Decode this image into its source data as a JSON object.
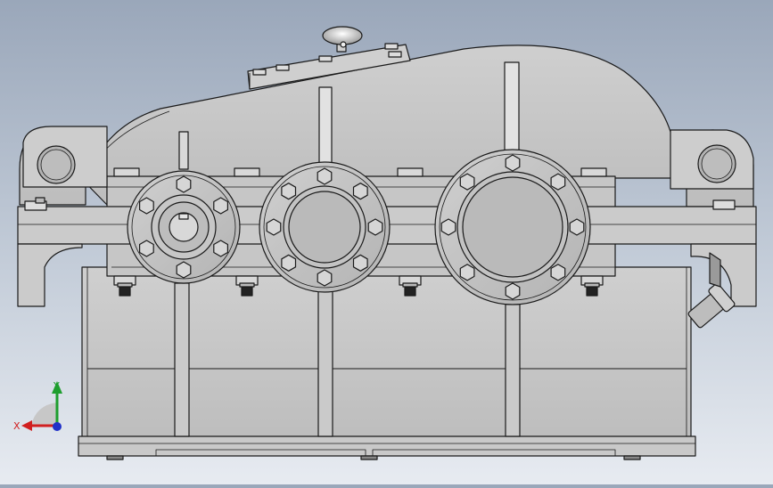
{
  "viewport": {
    "description_visible": false
  },
  "triad": {
    "x_label": "X",
    "y_label": "Y",
    "x_color": "#d11f1f",
    "y_color": "#1e9e2e",
    "z_color": "#2030c8"
  },
  "colors": {
    "body": "#c3c3c3",
    "body_light": "#d4d4d4",
    "body_dark": "#a9a9a9",
    "edge": "#1a1a1a",
    "flange": "#bcbcbc",
    "bolt": "#d8d8d8"
  },
  "model": {
    "shaft_count": 3,
    "flange_bolts": [
      6,
      8,
      8
    ]
  }
}
